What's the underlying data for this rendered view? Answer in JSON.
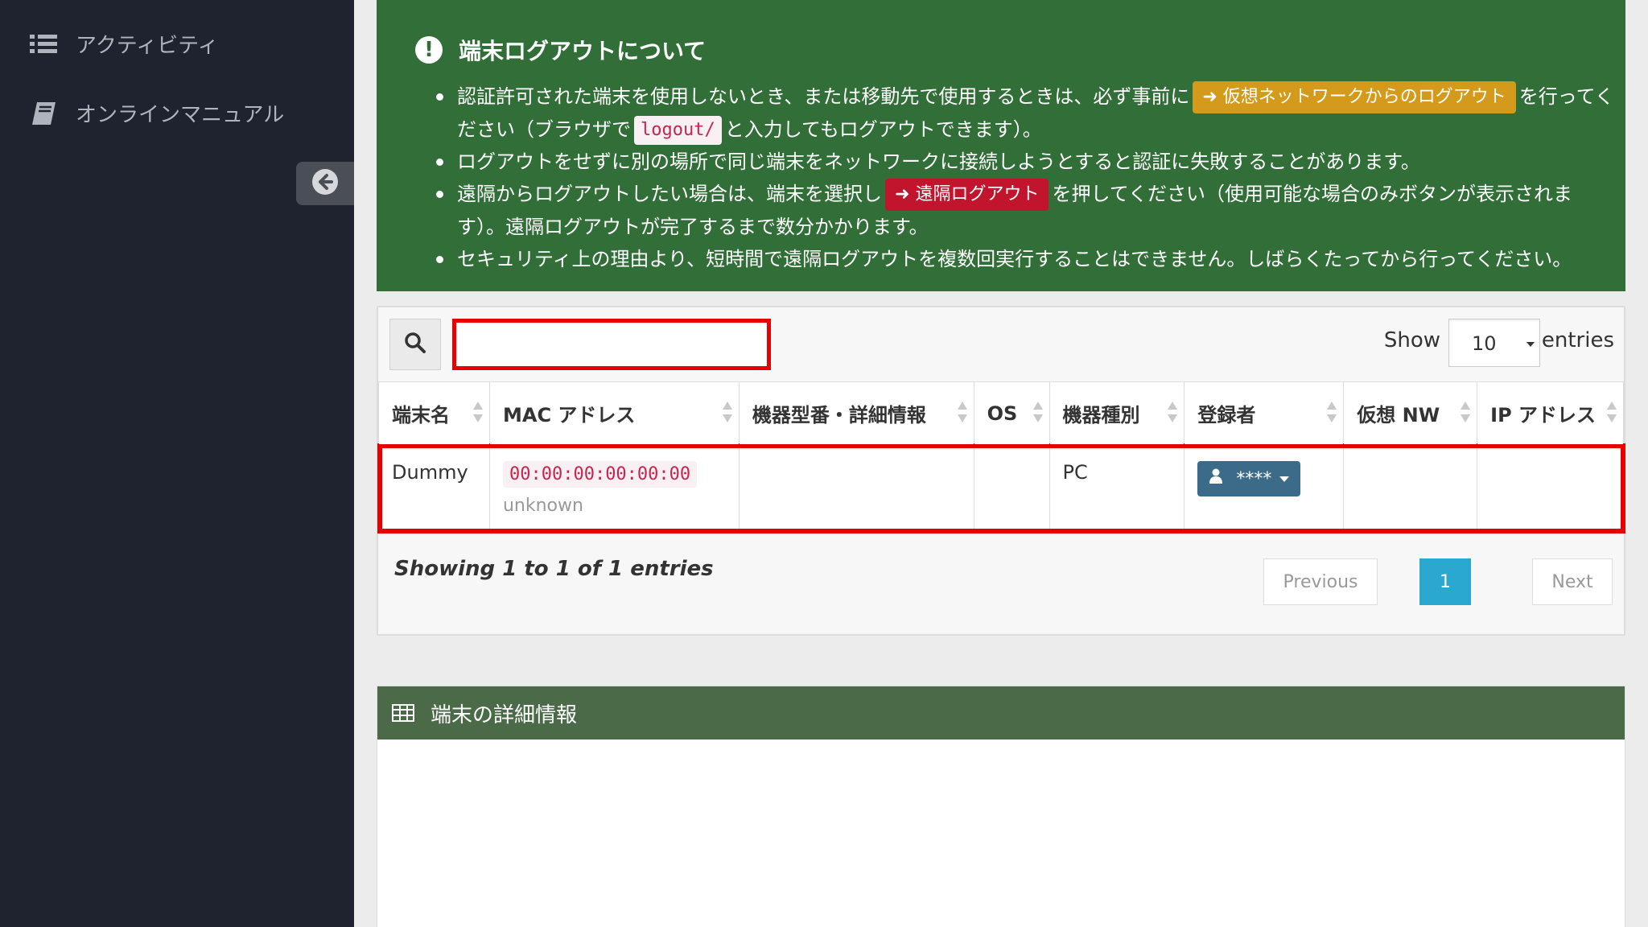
{
  "sidebar": {
    "items": [
      {
        "label": "アクティビティ",
        "icon": "list-icon"
      },
      {
        "label": "オンラインマニュアル",
        "icon": "book-icon"
      }
    ],
    "collapse_icon": "arrow-circle-left-icon"
  },
  "alert": {
    "title": "端末ログアウトについて",
    "bullets": {
      "b1_pre": "認証許可された端末を使用しないとき、または移動先で使用するときは、必ず事前に",
      "b1_btn": "仮想ネットワークからのログアウト",
      "b1_post": "を行ってください（ブラウザで",
      "b1_code": "logout/",
      "b1_end": "と入力してもログアウトできます）。",
      "b2": "ログアウトをせずに別の場所で同じ端末をネットワークに接続しようとすると認証に失敗することがあります。",
      "b3_pre": "遠隔からログアウトしたい場合は、端末を選択し",
      "b3_btn": "遠隔ログアウト",
      "b3_post": "を押してください（使用可能な場合のみボタンが表示されます）。遠隔ログアウトが完了するまで数分かかります。",
      "b4": "セキュリティ上の理由より、短時間で遠隔ログアウトを複数回実行することはできません。しばらくたってから行ってください。"
    },
    "colors": {
      "bg": "#316e38",
      "warn_btn": "#d39a1c",
      "danger_btn": "#c1152d"
    }
  },
  "table_controls": {
    "search_value": "",
    "show_label": "Show",
    "page_size": "10",
    "entries_label": "entries"
  },
  "table": {
    "headers": [
      "端末名",
      "MAC アドレス",
      "機器型番・詳細情報",
      "OS",
      "機器種別",
      "登録者",
      "仮想 NW",
      "IP アドレス"
    ],
    "rows": [
      {
        "name": "Dummy",
        "mac": "00:00:00:00:00:00",
        "vendor": "unknown",
        "model": "",
        "os": "",
        "type": "PC",
        "registrant": "****",
        "vnw": "",
        "ip": ""
      }
    ]
  },
  "pagination": {
    "info": "Showing 1 to 1 of 1 entries",
    "previous": "Previous",
    "current": "1",
    "next": "Next"
  },
  "details": {
    "title": "端末の詳細情報",
    "icon": "table-icon"
  }
}
